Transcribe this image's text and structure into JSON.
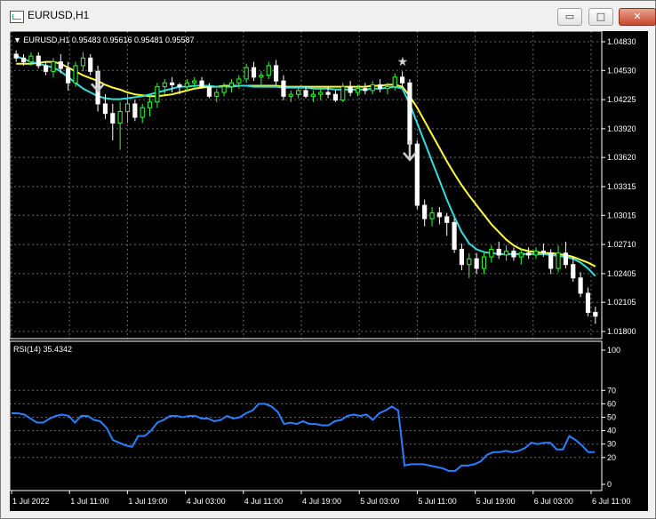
{
  "window": {
    "title": "EURUSD,H1",
    "minimize_label": "▭",
    "maximize_label": "□",
    "close_label": "✕"
  },
  "main_panel": {
    "header": "EURUSD,H1  0.95483 0.95616 0.95481 0.95587",
    "price_labels": [
      "1.04830",
      "1.04530",
      "1.04225",
      "1.03920",
      "1.03620",
      "1.03315",
      "1.03015",
      "1.02710",
      "1.02405",
      "1.02105",
      "1.01800"
    ]
  },
  "rsi_panel": {
    "header": "RSI(14) 35.4342",
    "levels": [
      "100",
      "70",
      "60",
      "50",
      "40",
      "30",
      "20",
      "0"
    ]
  },
  "time_labels": [
    "1 Jul 2022",
    "1 Jul 11:00",
    "1 Jul 19:00",
    "4 Jul 03:00",
    "4 Jul 11:00",
    "4 Jul 19:00",
    "5 Jul 03:00",
    "5 Jul 11:00",
    "5 Jul 19:00",
    "6 Jul 03:00",
    "6 Jul 11:00"
  ],
  "chart_data": [
    {
      "type": "candlestick",
      "symbol": "EURUSD",
      "timeframe": "H1",
      "ylim": [
        1.018,
        1.0483
      ],
      "bull_color": "#33ff33",
      "bear_color": "#ffffff",
      "ma_fast_color": "#33dddd",
      "ma_slow_color": "#ffff33",
      "candles": [
        [
          1.047,
          1.0474,
          1.0462,
          1.0466
        ],
        [
          1.0466,
          1.047,
          1.0458,
          1.0462
        ],
        [
          1.0462,
          1.0472,
          1.0458,
          1.0468
        ],
        [
          1.0468,
          1.0472,
          1.0455,
          1.0458
        ],
        [
          1.0458,
          1.0462,
          1.0448,
          1.0452
        ],
        [
          1.0452,
          1.0466,
          1.0446,
          1.0462
        ],
        [
          1.0462,
          1.047,
          1.045,
          1.0455
        ],
        [
          1.0455,
          1.0462,
          1.0432,
          1.044
        ],
        [
          1.044,
          1.0462,
          1.0436,
          1.0458
        ],
        [
          1.0458,
          1.0472,
          1.0452,
          1.0466
        ],
        [
          1.0466,
          1.047,
          1.0448,
          1.0452
        ],
        [
          1.0452,
          1.0458,
          1.041,
          1.0418
        ],
        [
          1.0418,
          1.0428,
          1.0402,
          1.0408
        ],
        [
          1.0408,
          1.0418,
          1.038,
          1.0398
        ],
        [
          1.0398,
          1.042,
          1.037,
          1.041
        ],
        [
          1.041,
          1.0428,
          1.0398,
          1.0418
        ],
        [
          1.0418,
          1.0422,
          1.04,
          1.0404
        ],
        [
          1.0404,
          1.0418,
          1.0398,
          1.0414
        ],
        [
          1.0414,
          1.0426,
          1.0405,
          1.042
        ],
        [
          1.042,
          1.044,
          1.0414,
          1.0436
        ],
        [
          1.0436,
          1.0444,
          1.0428,
          1.044
        ],
        [
          1.044,
          1.0446,
          1.043,
          1.0438
        ],
        [
          1.0438,
          1.044,
          1.0428,
          1.0436
        ],
        [
          1.0436,
          1.0444,
          1.0432,
          1.044
        ],
        [
          1.044,
          1.0446,
          1.0434,
          1.0442
        ],
        [
          1.0442,
          1.0446,
          1.0434,
          1.0436
        ],
        [
          1.0436,
          1.044,
          1.0424,
          1.0426
        ],
        [
          1.0426,
          1.0434,
          1.042,
          1.043
        ],
        [
          1.043,
          1.044,
          1.0426,
          1.0436
        ],
        [
          1.0436,
          1.0444,
          1.043,
          1.044
        ],
        [
          1.044,
          1.0448,
          1.0434,
          1.0444
        ],
        [
          1.0444,
          1.046,
          1.044,
          1.0456
        ],
        [
          1.0456,
          1.0462,
          1.0442,
          1.0446
        ],
        [
          1.0446,
          1.0452,
          1.0436,
          1.0448
        ],
        [
          1.0448,
          1.0462,
          1.0444,
          1.0458
        ],
        [
          1.0458,
          1.0464,
          1.0438,
          1.0442
        ],
        [
          1.0442,
          1.0448,
          1.0422,
          1.0426
        ],
        [
          1.0426,
          1.0432,
          1.042,
          1.0428
        ],
        [
          1.0428,
          1.0436,
          1.0424,
          1.0432
        ],
        [
          1.0432,
          1.0436,
          1.0424,
          1.0426
        ],
        [
          1.0426,
          1.0432,
          1.042,
          1.0428
        ],
        [
          1.0428,
          1.0434,
          1.0422,
          1.043
        ],
        [
          1.043,
          1.0436,
          1.0424,
          1.0428
        ],
        [
          1.0428,
          1.0432,
          1.042,
          1.0422
        ],
        [
          1.0422,
          1.044,
          1.042,
          1.0436
        ],
        [
          1.0436,
          1.0442,
          1.0426,
          1.043
        ],
        [
          1.043,
          1.0438,
          1.0426,
          1.0434
        ],
        [
          1.0434,
          1.044,
          1.0428,
          1.0432
        ],
        [
          1.0432,
          1.0442,
          1.0428,
          1.0438
        ],
        [
          1.0438,
          1.0444,
          1.043,
          1.0434
        ],
        [
          1.0434,
          1.044,
          1.0428,
          1.0436
        ],
        [
          1.0436,
          1.045,
          1.0432,
          1.0446
        ],
        [
          1.0446,
          1.0452,
          1.0436,
          1.044
        ],
        [
          1.044,
          1.0444,
          1.0372,
          1.0376
        ],
        [
          1.0376,
          1.038,
          1.0308,
          1.0312
        ],
        [
          1.0312,
          1.0318,
          1.029,
          1.0298
        ],
        [
          1.0298,
          1.031,
          1.029,
          1.0304
        ],
        [
          1.0304,
          1.031,
          1.0292,
          1.03
        ],
        [
          1.03,
          1.0304,
          1.028,
          1.0294
        ],
        [
          1.0294,
          1.0298,
          1.0262,
          1.0266
        ],
        [
          1.0266,
          1.0272,
          1.0244,
          1.025
        ],
        [
          1.025,
          1.0262,
          1.0236,
          1.0256
        ],
        [
          1.0256,
          1.0262,
          1.024,
          1.0246
        ],
        [
          1.0246,
          1.0262,
          1.024,
          1.0258
        ],
        [
          1.0258,
          1.027,
          1.0252,
          1.0266
        ],
        [
          1.0266,
          1.0274,
          1.0256,
          1.026
        ],
        [
          1.026,
          1.027,
          1.0254,
          1.0264
        ],
        [
          1.0264,
          1.0268,
          1.0254,
          1.0258
        ],
        [
          1.0258,
          1.0266,
          1.025,
          1.0262
        ],
        [
          1.0262,
          1.0268,
          1.0256,
          1.026
        ],
        [
          1.026,
          1.0268,
          1.0256,
          1.0264
        ],
        [
          1.0264,
          1.0272,
          1.0258,
          1.0262
        ],
        [
          1.0262,
          1.0266,
          1.024,
          1.0246
        ],
        [
          1.0246,
          1.027,
          1.0242,
          1.0262
        ],
        [
          1.0262,
          1.0274,
          1.0246,
          1.025
        ],
        [
          1.025,
          1.0258,
          1.0232,
          1.0236
        ],
        [
          1.0236,
          1.0242,
          1.0216,
          1.022
        ],
        [
          1.022,
          1.0226,
          1.0196,
          1.02
        ],
        [
          1.02,
          1.0206,
          1.0188,
          1.0196
        ]
      ],
      "ma_fast": [
        1.0468,
        1.0465,
        1.0462,
        1.046,
        1.0458,
        1.0456,
        1.0452,
        1.0446,
        1.044,
        1.0434,
        1.043,
        1.0426,
        1.0424,
        1.0423,
        1.0423,
        1.0424,
        1.0425,
        1.0426,
        1.0428,
        1.043,
        1.0432,
        1.0434,
        1.0436,
        1.0436,
        1.0437,
        1.0437,
        1.0437,
        1.0436,
        1.0436,
        1.0436,
        1.0437,
        1.0437,
        1.0436,
        1.0436,
        1.0436,
        1.0436,
        1.0435,
        1.0435,
        1.0435,
        1.0435,
        1.0434,
        1.0434,
        1.0434,
        1.0433,
        1.0433,
        1.0433,
        1.0433,
        1.0433,
        1.0434,
        1.0434,
        1.0435,
        1.0436,
        1.0434,
        1.0418,
        1.0398,
        1.0378,
        1.0358,
        1.0338,
        1.0318,
        1.03,
        1.0284,
        1.0272,
        1.0266,
        1.0263,
        1.0262,
        1.0261,
        1.0261,
        1.0261,
        1.0261,
        1.0261,
        1.0261,
        1.0261,
        1.026,
        1.0259,
        1.0258,
        1.0256,
        1.0252,
        1.0246,
        1.0238
      ],
      "ma_slow": [
        1.046,
        1.046,
        1.046,
        1.0461,
        1.0462,
        1.0462,
        1.046,
        1.0456,
        1.0452,
        1.0448,
        1.0445,
        1.0442,
        1.0438,
        1.0435,
        1.0433,
        1.043,
        1.0428,
        1.0427,
        1.0426,
        1.0426,
        1.0427,
        1.0428,
        1.043,
        1.0432,
        1.0434,
        1.0435,
        1.0436,
        1.0436,
        1.0437,
        1.0437,
        1.0437,
        1.0437,
        1.0437,
        1.0437,
        1.0437,
        1.0437,
        1.0436,
        1.0436,
        1.0436,
        1.0436,
        1.0436,
        1.0436,
        1.0436,
        1.0436,
        1.0436,
        1.0436,
        1.0436,
        1.0436,
        1.0437,
        1.0437,
        1.0438,
        1.0438,
        1.0436,
        1.0426,
        1.0414,
        1.04,
        1.0386,
        1.0372,
        1.0358,
        1.0345,
        1.0333,
        1.0322,
        1.0312,
        1.0302,
        1.0292,
        1.0284,
        1.0276,
        1.027,
        1.0266,
        1.0264,
        1.0263,
        1.0262,
        1.0262,
        1.0261,
        1.026,
        1.0258,
        1.0255,
        1.0252,
        1.0248
      ],
      "arrows": [
        {
          "index": 11,
          "price": 1.0452,
          "kind": "down-arrow"
        },
        {
          "index": 53,
          "price": 1.038,
          "kind": "down-arrow"
        },
        {
          "index": 52,
          "price": 1.0456,
          "kind": "star"
        }
      ]
    },
    {
      "type": "line",
      "title": "RSI(14) 35.4342",
      "ylim": [
        0,
        100
      ],
      "levels": [
        70,
        60,
        50,
        40,
        30,
        20
      ],
      "color": "#2a7fff",
      "values": [
        53,
        53,
        52,
        49,
        46,
        46,
        49,
        51,
        52,
        51,
        46,
        51,
        51,
        48,
        47,
        42,
        33,
        31,
        29,
        28,
        36,
        36,
        40,
        46,
        48,
        51,
        51,
        50,
        51,
        51,
        49,
        49,
        47,
        48,
        51,
        49,
        50,
        53,
        55,
        60,
        60,
        58,
        54,
        45,
        46,
        45,
        47,
        45,
        45,
        44,
        44,
        47,
        48,
        51,
        52,
        51,
        52,
        48,
        53,
        55,
        58,
        55,
        14,
        15,
        15,
        15,
        14,
        13,
        12,
        10,
        10,
        14,
        14,
        15,
        17,
        22,
        24,
        24,
        25,
        24,
        25,
        27,
        31,
        30,
        31,
        31,
        26,
        26,
        36,
        33,
        29,
        24,
        24
      ]
    }
  ]
}
